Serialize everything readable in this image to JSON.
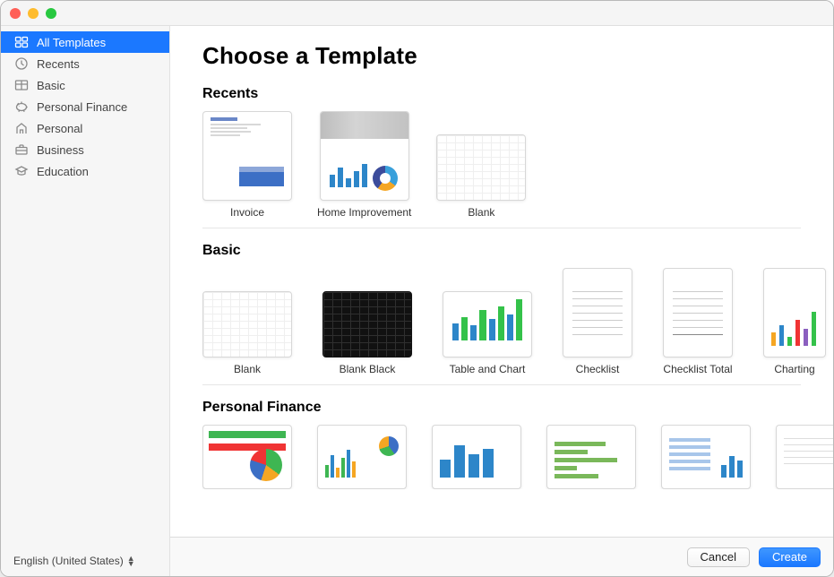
{
  "header": {
    "title": "Choose a Template"
  },
  "sidebar": {
    "items": [
      {
        "label": "All Templates",
        "icon": "templates-icon",
        "active": true
      },
      {
        "label": "Recents",
        "icon": "recents-icon"
      },
      {
        "label": "Basic",
        "icon": "basic-icon"
      },
      {
        "label": "Personal Finance",
        "icon": "finance-icon"
      },
      {
        "label": "Personal",
        "icon": "personal-icon"
      },
      {
        "label": "Business",
        "icon": "business-icon"
      },
      {
        "label": "Education",
        "icon": "education-icon"
      }
    ],
    "footer": {
      "language": "English (United States)"
    }
  },
  "sections": {
    "recents": {
      "title": "Recents",
      "templates": [
        {
          "label": "Invoice"
        },
        {
          "label": "Home Improvement"
        },
        {
          "label": "Blank"
        }
      ]
    },
    "basic": {
      "title": "Basic",
      "templates": [
        {
          "label": "Blank"
        },
        {
          "label": "Blank Black"
        },
        {
          "label": "Table and Chart"
        },
        {
          "label": "Checklist"
        },
        {
          "label": "Checklist Total"
        },
        {
          "label": "Charting"
        }
      ]
    },
    "personal_finance": {
      "title": "Personal Finance"
    }
  },
  "footer": {
    "cancel": "Cancel",
    "create": "Create"
  }
}
